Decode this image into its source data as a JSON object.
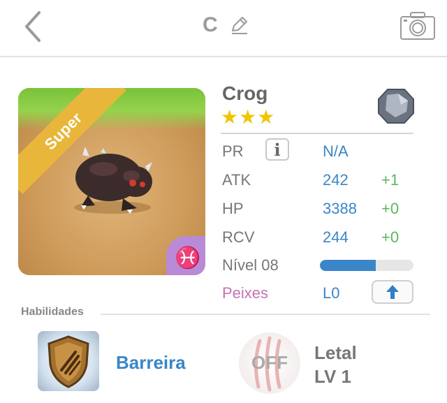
{
  "header": {
    "title": "C"
  },
  "monster": {
    "name": "Crog",
    "stars": "★★★",
    "grade_ribbon": "Super",
    "attribute_symbol": "♓"
  },
  "stats": {
    "pr": {
      "label": "PR",
      "value": "N/A",
      "info_glyph": "i"
    },
    "atk": {
      "label": "ATK",
      "value": "242",
      "bonus": "+1"
    },
    "hp": {
      "label": "HP",
      "value": "3388",
      "bonus": "+0"
    },
    "rcv": {
      "label": "RCV",
      "value": "244",
      "bonus": "+0"
    },
    "level": {
      "label": "Nível 08",
      "progress": 0.6
    },
    "attribute": {
      "label": "Peixes",
      "value": "L0"
    }
  },
  "skills": {
    "section_title": "Habilidades",
    "active_skill": "Barreira",
    "leader_status": "OFF",
    "leader_name": "Letal",
    "leader_level": "LV 1"
  },
  "colors": {
    "accent_blue": "#3a86c8",
    "bonus_green": "#5cb85c",
    "star_gold": "#f2c400",
    "ribbon_gold": "#e8b63a",
    "attribute_purple": "#c673b4"
  },
  "icons": {
    "back": "chevron-left-icon",
    "edit": "pencil-icon",
    "camera": "camera-icon",
    "type": "rock-type-icon",
    "info": "info-icon",
    "upgrade": "arrow-up-icon",
    "skill": "shield-icon"
  }
}
